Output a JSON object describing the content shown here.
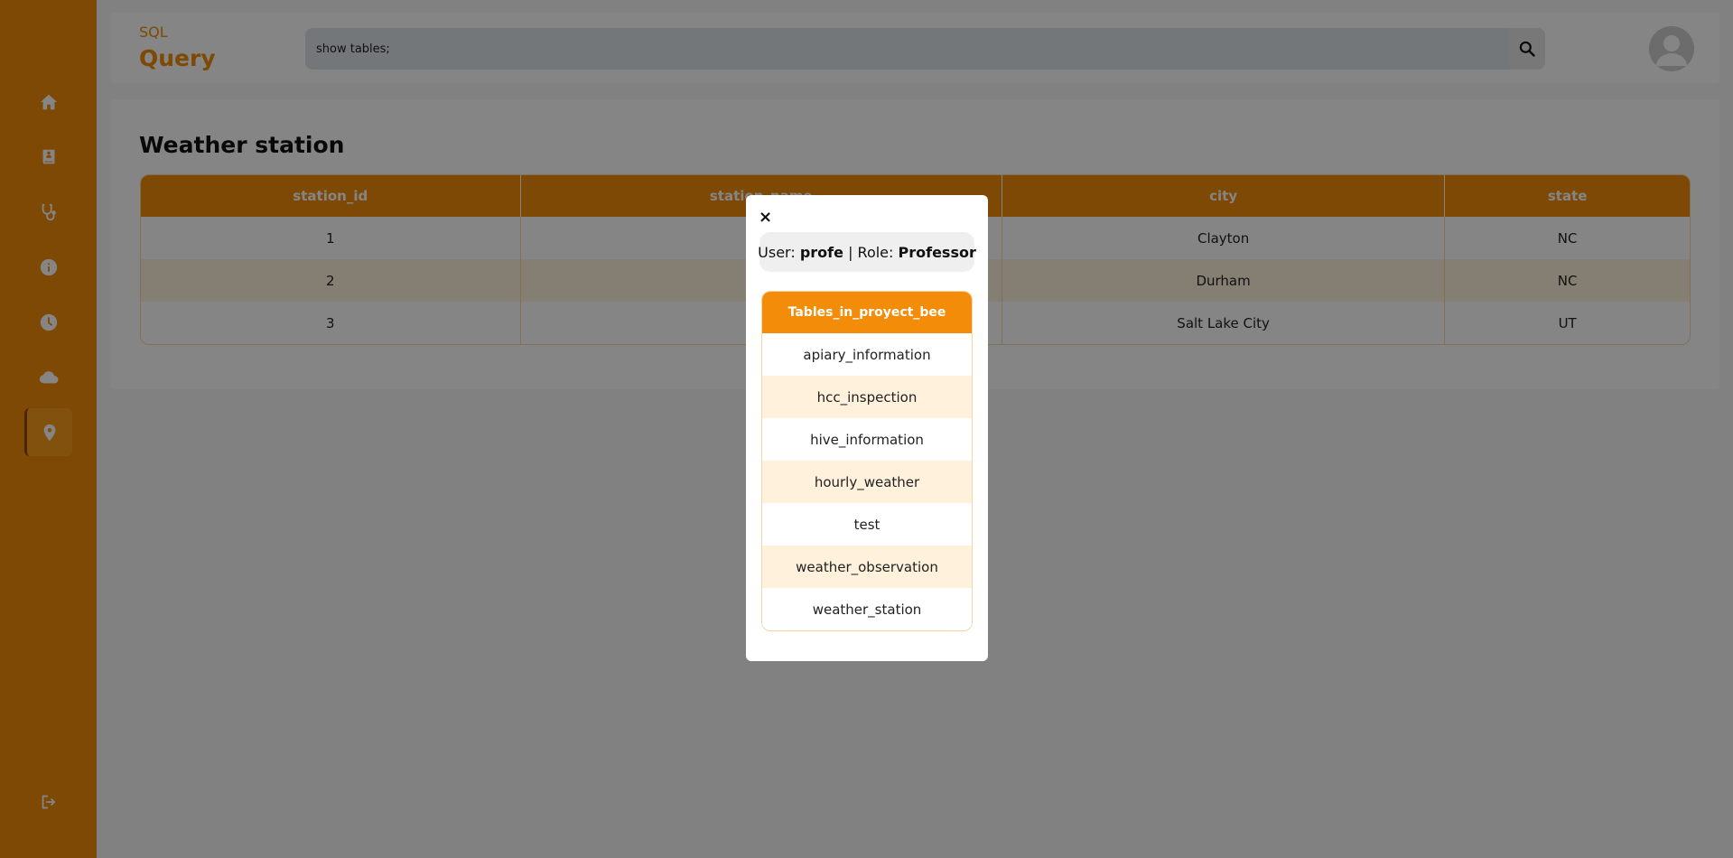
{
  "sidebar": {
    "items": [
      {
        "icon": "home-icon"
      },
      {
        "icon": "book-icon"
      },
      {
        "icon": "stethoscope-icon"
      },
      {
        "icon": "info-icon"
      },
      {
        "icon": "clock-icon"
      },
      {
        "icon": "cloud-icon"
      },
      {
        "icon": "location-pin-icon",
        "active": true
      }
    ],
    "logout_icon": "logout-icon"
  },
  "header": {
    "brand_small": "SQL",
    "brand_big": "Query",
    "search_value": "show tables;"
  },
  "main": {
    "title": "Weather station",
    "columns": [
      "station_id",
      "station_name",
      "city",
      "state"
    ],
    "rows": [
      [
        "1",
        "",
        "Clayton",
        "NC"
      ],
      [
        "2",
        "",
        "Durham",
        "NC"
      ],
      [
        "3",
        "",
        "Salt Lake City",
        "UT"
      ]
    ]
  },
  "modal": {
    "close_label": "×",
    "user_prefix": "User: ",
    "user_name": "profe",
    "role_prefix": " | Role: ",
    "role_name": "Professor",
    "tables_header": "Tables_in_proyect_bee",
    "tables": [
      "apiary_information",
      "hcc_inspection",
      "hive_information",
      "hourly_weather",
      "test",
      "weather_observation",
      "weather_station"
    ]
  },
  "colors": {
    "accent": "#f28c09",
    "row_alt": "#fff1dc"
  }
}
